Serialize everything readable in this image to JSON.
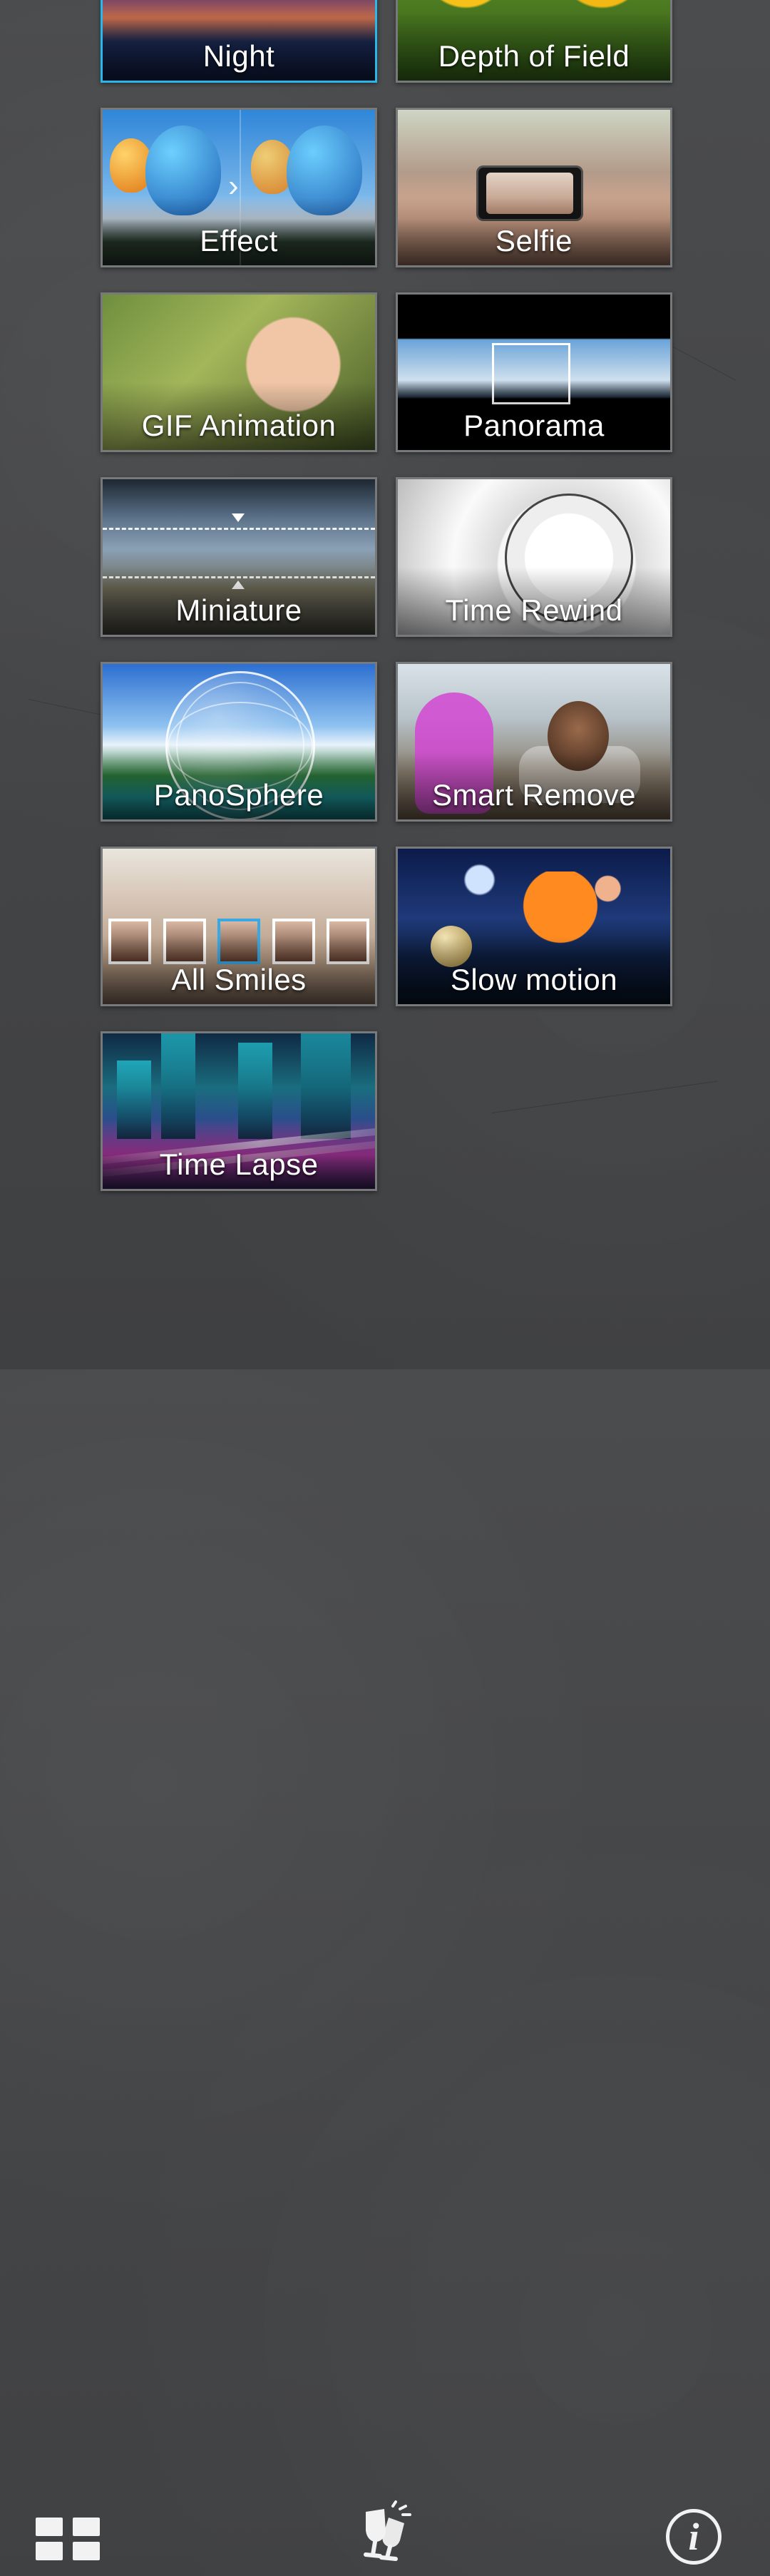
{
  "modes": [
    {
      "id": "night",
      "label": "Night",
      "selected": true
    },
    {
      "id": "depth-of-field",
      "label": "Depth of Field",
      "selected": false
    },
    {
      "id": "effect",
      "label": "Effect",
      "selected": false
    },
    {
      "id": "selfie",
      "label": "Selfie",
      "selected": false
    },
    {
      "id": "gif-animation",
      "label": "GIF Animation",
      "selected": false
    },
    {
      "id": "panorama",
      "label": "Panorama",
      "selected": false
    },
    {
      "id": "miniature",
      "label": "Miniature",
      "selected": false
    },
    {
      "id": "time-rewind",
      "label": "Time Rewind",
      "selected": false
    },
    {
      "id": "panosphere",
      "label": "PanoSphere",
      "selected": false
    },
    {
      "id": "smart-remove",
      "label": "Smart Remove",
      "selected": false
    },
    {
      "id": "all-smiles",
      "label": "All Smiles",
      "selected": false
    },
    {
      "id": "slow-motion",
      "label": "Slow motion",
      "selected": false
    },
    {
      "id": "time-lapse",
      "label": "Time Lapse",
      "selected": false
    }
  ],
  "bottom_bar": {
    "left_icon": "grid-view-icon",
    "center_icon": "cheers-icon",
    "right_icon": "info-icon",
    "info_glyph": "i"
  },
  "colors": {
    "selected_border": "#27b7ea",
    "tile_border": "#77797b",
    "background": "#444547"
  }
}
